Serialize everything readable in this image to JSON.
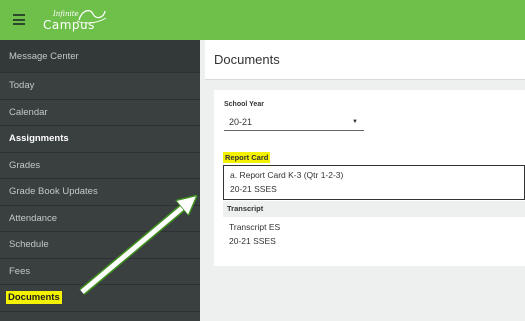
{
  "header": {
    "logo_line1": "Infinite",
    "logo_line2": "Campus"
  },
  "sidebar": {
    "items": [
      {
        "label": "Message Center"
      },
      {
        "label": "Today"
      },
      {
        "label": "Calendar"
      },
      {
        "label": "Assignments"
      },
      {
        "label": "Grades"
      },
      {
        "label": "Grade Book Updates"
      },
      {
        "label": "Attendance"
      },
      {
        "label": "Schedule"
      },
      {
        "label": "Fees"
      },
      {
        "label": "Documents"
      }
    ]
  },
  "main": {
    "title": "Documents",
    "school_year_label": "School Year",
    "school_year_value": "20-21",
    "sections": [
      {
        "heading": "Report Card",
        "document": {
          "name": "a. Report Card K-3 (Qtr 1-2-3)",
          "sub": "20-21 SSES"
        }
      },
      {
        "heading": "Transcript",
        "document": {
          "name": "Transcript ES",
          "sub": "20-21 SSES"
        }
      }
    ]
  },
  "colors": {
    "topbar": "#6fbf4b",
    "sidebar": "#3a3f40",
    "highlight": "#f5f200",
    "arrow_outline": "#3f8f1f"
  }
}
